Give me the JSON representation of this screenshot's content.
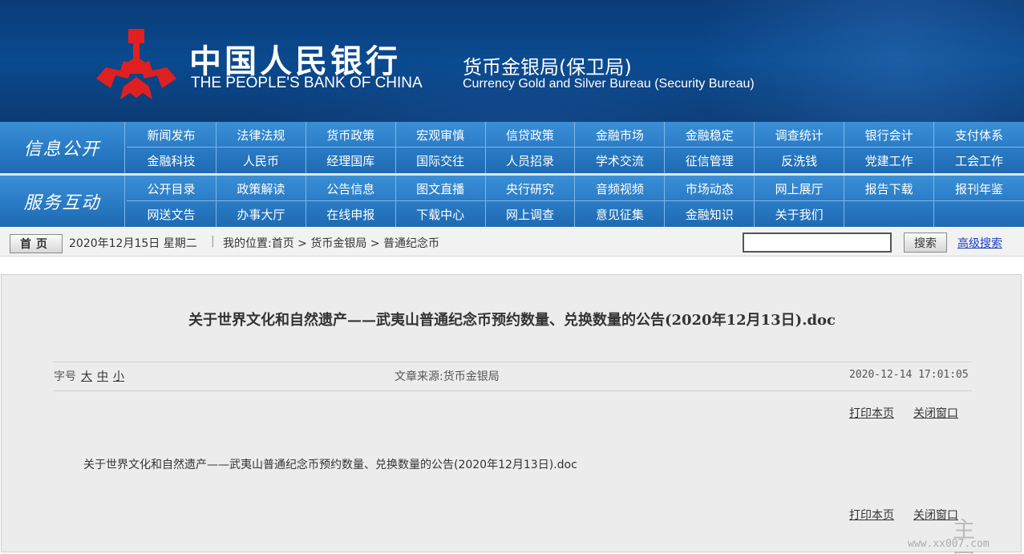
{
  "header": {
    "bank_name_cn": "中国人民银行",
    "bank_name_en": "THE PEOPLE'S BANK OF CHINA",
    "bureau_cn": "货币金银局(保卫局)",
    "bureau_en": "Currency  Gold and Silver Bureau (Security Bureau)",
    "logo_color": "#e02020"
  },
  "nav": {
    "section1": {
      "title": "信息公开",
      "row1": [
        "新闻发布",
        "法律法规",
        "货币政策",
        "宏观审慎",
        "信贷政策",
        "金融市场",
        "金融稳定",
        "调查统计",
        "银行会计",
        "支付体系"
      ],
      "row2": [
        "金融科技",
        "人民币",
        "经理国库",
        "国际交往",
        "人员招录",
        "学术交流",
        "征信管理",
        "反洗钱",
        "党建工作",
        "工会工作"
      ]
    },
    "section2": {
      "title": "服务互动",
      "row1": [
        "公开目录",
        "政策解读",
        "公告信息",
        "图文直播",
        "央行研究",
        "音频视频",
        "市场动态",
        "网上展厅",
        "报告下载",
        "报刊年鉴"
      ],
      "row2": [
        "网送文告",
        "办事大厅",
        "在线申报",
        "下载中心",
        "网上调查",
        "意见征集",
        "金融知识",
        "关于我们"
      ]
    }
  },
  "crumbbar": {
    "home_label": "首页",
    "date": "2020年12月15日  星期二",
    "divider": "|",
    "location": "我的位置:首页 > 货币金银局 > 普通纪念币",
    "search_value": "",
    "search_button": "搜索",
    "advanced_search": "高级搜索"
  },
  "article": {
    "title": "关于世界文化和自然遗产——武夷山普通纪念币预约数量、兑换数量的公告(2020年12月13日).doc",
    "font_size_label": "字号",
    "font_sizes": [
      "大",
      "中",
      "小"
    ],
    "source": "文章来源:货币金银局",
    "datetime": "2020-12-14 17:01:05",
    "print_label": "打印本页",
    "close_label": "关闭窗口",
    "body": "关于世界文化和自然遗产——武夷山普通纪念币预约数量、兑换数量的公告(2020年12月13日).doc",
    "watermark_big": "主网",
    "watermark_url": "www.xx007.com"
  }
}
